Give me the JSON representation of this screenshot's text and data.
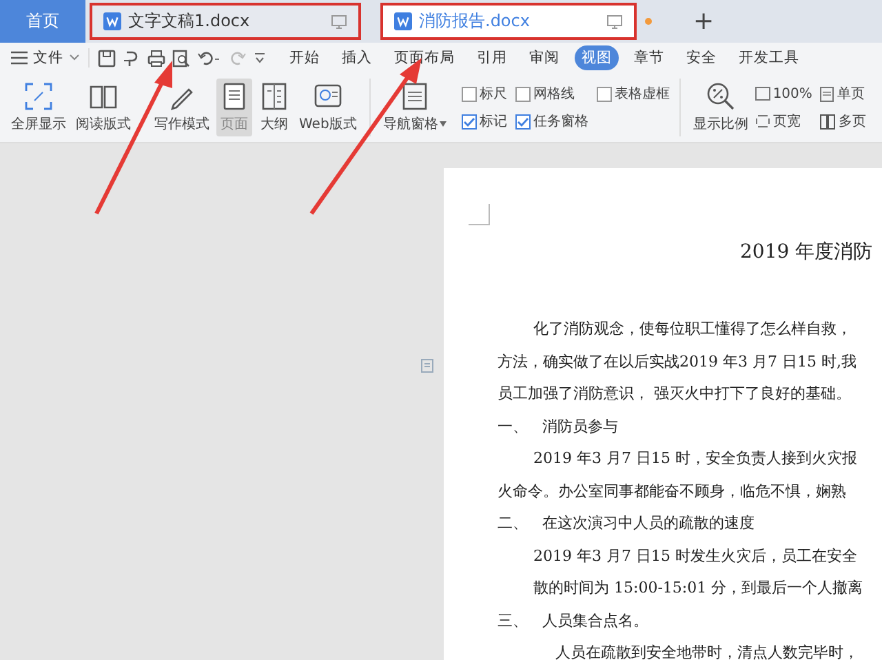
{
  "tabs": [
    {
      "kind": "home",
      "label": "首页",
      "selected": false,
      "highlighted": false,
      "modified": false
    },
    {
      "kind": "doc",
      "label": "文字文稿1.docx",
      "selected": false,
      "highlighted": true,
      "modified": false
    },
    {
      "kind": "doc",
      "label": "消防报告.docx",
      "selected": true,
      "highlighted": true,
      "modified": true
    }
  ],
  "new_tab": "+",
  "file_menu": "文件",
  "menu_tabs": [
    {
      "label": "开始",
      "selected": false
    },
    {
      "label": "插入",
      "selected": false
    },
    {
      "label": "页面布局",
      "selected": false
    },
    {
      "label": "引用",
      "selected": false
    },
    {
      "label": "审阅",
      "selected": false
    },
    {
      "label": "视图",
      "selected": true
    },
    {
      "label": "章节",
      "selected": false
    },
    {
      "label": "安全",
      "selected": false
    },
    {
      "label": "开发工具",
      "selected": false
    }
  ],
  "view_buttons": [
    {
      "kind": "fullscreen",
      "label": "全屏显示",
      "selected": false
    },
    {
      "kind": "read",
      "label": "阅读版式",
      "selected": false
    },
    {
      "kind": "write",
      "label": "写作模式",
      "selected": false
    },
    {
      "kind": "page",
      "label": "页面",
      "selected": true
    },
    {
      "kind": "outline",
      "label": "大纲",
      "selected": false
    },
    {
      "kind": "web",
      "label": "Web版式",
      "selected": false
    }
  ],
  "nav_pane": "导航窗格",
  "checkboxes": [
    {
      "label": "标尺",
      "checked": false
    },
    {
      "label": "网格线",
      "checked": false
    },
    {
      "label": "表格虚框",
      "checked": false
    },
    {
      "label": "标记",
      "checked": true
    },
    {
      "label": "任务窗格",
      "checked": true
    }
  ],
  "zoom": {
    "label": "显示比例",
    "percent": "100%",
    "page_width": "页宽",
    "single_page": "单页",
    "multi_page": "多页"
  },
  "document": {
    "title": "2019 年度消防",
    "lines": [
      {
        "kind": "indent",
        "text": "化了消防观念，使每位职工懂得了怎么样自救，"
      },
      {
        "kind": "plain",
        "text": "方法，确实做了在以后实战2019 年3 月7 日15 时,我"
      },
      {
        "kind": "plain",
        "text": "员工加强了消防意识， 强灭火中打下了良好的基础。"
      },
      {
        "kind": "heading",
        "number": "一、",
        "text": "消防员参与"
      },
      {
        "kind": "indent",
        "text": "2019 年3 月7 日15 时，安全负责人接到火灾报"
      },
      {
        "kind": "plain",
        "text": "火命令。办公室同事都能奋不顾身，临危不惧，娴熟"
      },
      {
        "kind": "heading",
        "number": "二、",
        "text": "在这次演习中人员的疏散的速度"
      },
      {
        "kind": "indent",
        "text": "2019 年3 月7 日15 时发生火灾后，员工在安全"
      },
      {
        "kind": "indent",
        "text": "散的时间为 15:00-15:01 分，到最后一个人撤离"
      },
      {
        "kind": "heading",
        "number": "三、",
        "text": "人员集合点名。"
      },
      {
        "kind": "indent2",
        "text": "人员在疏散到安全地带时，清点人数完毕时，"
      }
    ]
  }
}
